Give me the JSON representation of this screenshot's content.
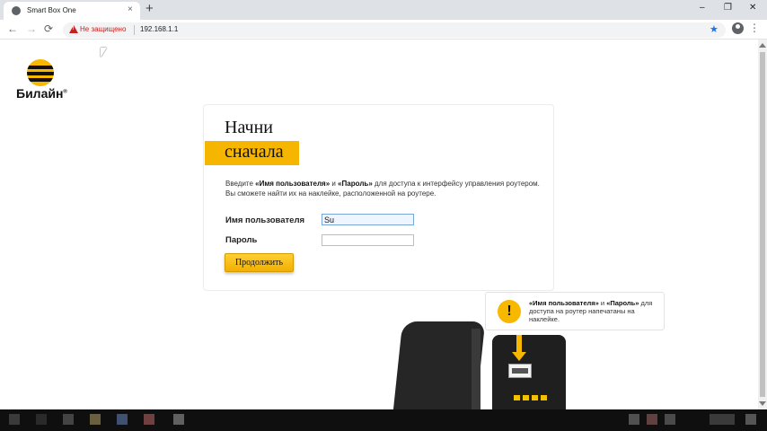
{
  "browser": {
    "tab_title": "Smart Box One",
    "tab_close": "×",
    "new_tab": "+",
    "window_controls": [
      "–",
      "❐",
      "✕"
    ],
    "nav": {
      "back": "←",
      "forward": "→",
      "reload": "⟳"
    },
    "security_label": "Не защищено",
    "url": "192.168.1.1",
    "bookmark_icon": "star-icon",
    "menu": "⋮"
  },
  "logo": {
    "brand": "Билайн",
    "mark": "®"
  },
  "login_card": {
    "heading_line1": "Начни",
    "heading_line2": "сначала",
    "desc_prefix": "Введите ",
    "desc_username": "«Имя пользователя»",
    "desc_and": " и ",
    "desc_password": "«Пароль»",
    "desc_suffix": " для доступа к интерфейсу управления роутером.",
    "desc_line2": "Вы сможете найти их на наклейке, расположенной на роутере.",
    "username_label": "Имя пользователя",
    "username_value": "Su",
    "password_label": "Пароль",
    "password_value": "",
    "submit_label": "Продолжить"
  },
  "hint": {
    "icon": "!",
    "username": "«Имя пользователя»",
    "and": " и ",
    "password": "«Пароль»",
    "text": " для доступа на роутер напечатаны на наклейке."
  },
  "colors": {
    "brand_yellow": "#f8b800",
    "insecure_red": "#c5221f",
    "star_blue": "#1a73e8"
  }
}
